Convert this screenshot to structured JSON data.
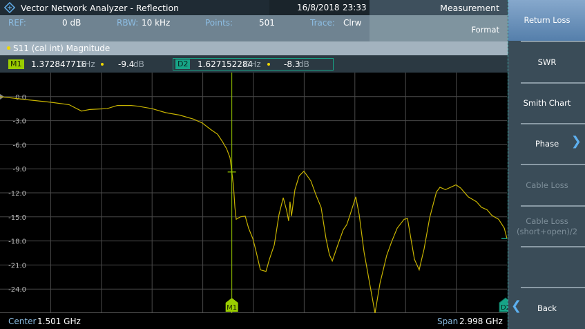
{
  "header": {
    "title": "Vector Network Analyzer - Reflection",
    "date": "16/8/2018",
    "time": "23:33",
    "menu_title": "Measurement",
    "menu_subtitle": "Format"
  },
  "info": {
    "ref_label": "REF:",
    "ref_value": "0 dB",
    "rbw_label": "RBW:",
    "rbw_value": "10 kHz",
    "points_label": "Points:",
    "points_value": "501",
    "trace_label": "Trace:",
    "trace_value": "Clrw"
  },
  "trace_title": "S11 (cal int) Magnitude",
  "markers": {
    "m1": {
      "label": "M1",
      "freq": "1.372847716",
      "freq_unit": "GHz",
      "value": "-9.4",
      "value_unit": "dB"
    },
    "d2": {
      "label": "D2",
      "freq": "1.627152284",
      "freq_unit": "GHz",
      "value": "-8.3",
      "value_unit": "dB"
    }
  },
  "footer": {
    "center_label": "Center",
    "center_value": "1.501 GHz",
    "span_label": "Span",
    "span_value": "2.998 GHz"
  },
  "softkeys": [
    {
      "label": "Return Loss",
      "state": "active"
    },
    {
      "label": "SWR",
      "state": "enabled"
    },
    {
      "label": "Smith Chart",
      "state": "enabled"
    },
    {
      "label": "Phase",
      "state": "enabled",
      "icon": "chevron-right-icon"
    },
    {
      "label": "Cable Loss",
      "state": "disabled"
    },
    {
      "label": "Cable Loss (short+open)/2",
      "state": "disabled"
    },
    {
      "label": "",
      "state": "empty"
    },
    {
      "label": "Back",
      "state": "enabled",
      "icon": "chevron-left-icon"
    }
  ],
  "colors": {
    "trace": "#c8b400",
    "m1": "#9acd00",
    "d2": "#17a487",
    "active_key": "#6a90ba",
    "grid": "#4a4a4a"
  },
  "chart_data": {
    "type": "line",
    "xlabel": "",
    "ylabel": "",
    "xlim": [
      0.002,
      3.0
    ],
    "ylim": [
      -27,
      3
    ],
    "y_ticks": [
      0,
      -3,
      -6,
      -9,
      -12,
      -15,
      -18,
      -21,
      -24
    ],
    "y_tick_labels": [
      "0.0",
      "-3.0",
      "-6.0",
      "-9.0",
      "-12.0",
      "-15.0",
      "-18.0",
      "-21.0",
      "-24.0"
    ],
    "grid": true,
    "markers": [
      {
        "name": "M1",
        "x": 1.373,
        "y": -9.4
      },
      {
        "name": "D2",
        "x": 3.0,
        "y": -17.7
      }
    ],
    "series": [
      {
        "x": [
          0.002,
          0.165,
          0.3,
          0.41,
          0.484,
          0.533,
          0.635,
          0.696,
          0.778,
          0.819,
          0.901,
          0.982,
          1.064,
          1.146,
          1.199,
          1.248,
          1.289,
          1.317,
          1.342,
          1.362,
          1.373,
          1.383,
          1.391,
          1.399,
          1.423,
          1.452,
          1.472,
          1.497,
          1.513,
          1.542,
          1.575,
          1.595,
          1.624,
          1.652,
          1.677,
          1.697,
          1.709,
          1.717,
          1.726,
          1.746,
          1.771,
          1.799,
          1.84,
          1.873,
          1.901,
          1.93,
          1.95,
          1.967,
          2.003,
          2.032,
          2.052,
          2.073,
          2.106,
          2.126,
          2.155,
          2.195,
          2.22,
          2.249,
          2.289,
          2.318,
          2.351,
          2.392,
          2.412,
          2.432,
          2.453,
          2.481,
          2.51,
          2.543,
          2.583,
          2.604,
          2.636,
          2.698,
          2.726,
          2.771,
          2.82,
          2.849,
          2.882,
          2.91,
          2.951,
          2.984,
          3.0
        ],
        "y": [
          0.0,
          -0.4,
          -0.7,
          -1.0,
          -1.8,
          -1.6,
          -1.5,
          -1.1,
          -1.1,
          -1.2,
          -1.5,
          -2.0,
          -2.3,
          -2.8,
          -3.3,
          -4.1,
          -4.7,
          -5.6,
          -6.5,
          -7.6,
          -9.4,
          -11.2,
          -13.8,
          -15.3,
          -15.0,
          -14.9,
          -16.4,
          -17.7,
          -19.0,
          -21.6,
          -21.8,
          -20.3,
          -18.5,
          -14.7,
          -12.6,
          -14.2,
          -15.5,
          -13.1,
          -14.9,
          -11.6,
          -9.9,
          -9.3,
          -10.5,
          -12.4,
          -13.8,
          -17.7,
          -19.7,
          -20.5,
          -18.3,
          -16.6,
          -16.0,
          -14.7,
          -12.5,
          -14.7,
          -19.4,
          -24.1,
          -27.0,
          -23.3,
          -19.8,
          -18.1,
          -16.4,
          -15.3,
          -15.2,
          -17.7,
          -20.3,
          -21.6,
          -19.0,
          -15.1,
          -11.9,
          -11.3,
          -11.6,
          -11.0,
          -11.4,
          -12.5,
          -13.1,
          -13.8,
          -14.1,
          -14.8,
          -15.3,
          -16.4,
          -17.7
        ]
      }
    ]
  }
}
